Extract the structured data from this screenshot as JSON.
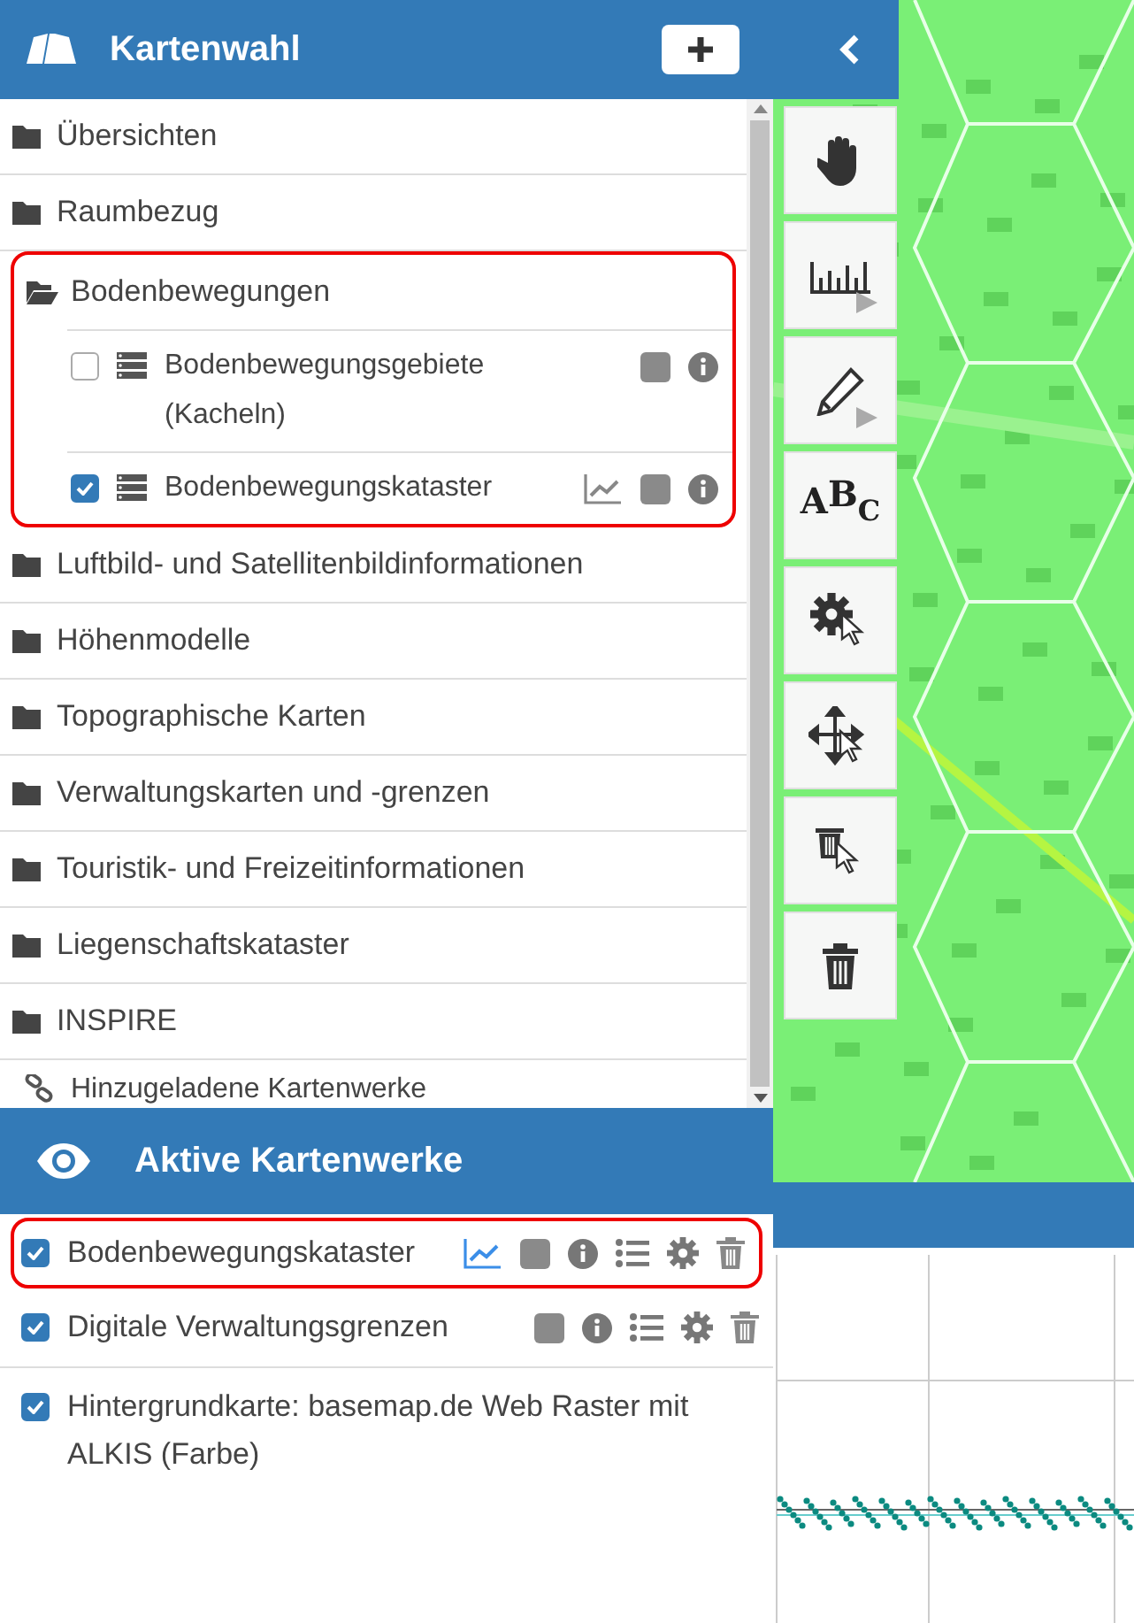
{
  "header": {
    "title": "Kartenwahl"
  },
  "tree": [
    {
      "kind": "folder",
      "label": "Übersichten",
      "expanded": false
    },
    {
      "kind": "folder",
      "label": "Raumbezug",
      "expanded": false
    },
    {
      "kind": "folder",
      "label": "Bodenbewegungen",
      "expanded": true,
      "highlighted": true,
      "children": [
        {
          "label": "Bodenbewegungsgebiete (Kacheln)",
          "checked": false,
          "chart": false
        },
        {
          "label": "Bodenbewegungskataster",
          "checked": true,
          "chart": true
        }
      ]
    },
    {
      "kind": "folder",
      "label": "Luftbild- und Satellitenbildinformationen",
      "expanded": false
    },
    {
      "kind": "folder",
      "label": "Höhenmodelle",
      "expanded": false
    },
    {
      "kind": "folder",
      "label": "Topographische Karten",
      "expanded": false
    },
    {
      "kind": "folder",
      "label": "Verwaltungskarten und -grenzen",
      "expanded": false
    },
    {
      "kind": "folder",
      "label": "Touristik- und Freizeitinformationen",
      "expanded": false
    },
    {
      "kind": "folder",
      "label": "Liegenschaftskataster",
      "expanded": false
    },
    {
      "kind": "folder",
      "label": "INSPIRE",
      "expanded": false
    },
    {
      "kind": "link",
      "label": "Hinzugeladene Kartenwerke"
    }
  ],
  "active": {
    "title": "Aktive Kartenwerke",
    "layers": [
      {
        "label": "Bodenbewegungskataster",
        "checked": true,
        "highlighted": true,
        "tools": true,
        "chart": true
      },
      {
        "label": "Digitale Verwaltungsgrenzen",
        "checked": true,
        "highlighted": false,
        "tools": true,
        "chart": false
      },
      {
        "label": "Hintergrundkarte: basemap.de Web Raster mit ALKIS (Farbe)",
        "checked": true,
        "highlighted": false,
        "tools": false,
        "chart": false
      }
    ]
  },
  "tools": [
    {
      "kind": "pan",
      "submenu": false
    },
    {
      "kind": "measure",
      "submenu": true
    },
    {
      "kind": "draw",
      "submenu": true
    },
    {
      "kind": "text",
      "glyph": "ABC",
      "submenu": false
    },
    {
      "kind": "select-settings",
      "submenu": false
    },
    {
      "kind": "select-move",
      "submenu": false
    },
    {
      "kind": "select-delete",
      "submenu": false
    },
    {
      "kind": "delete",
      "submenu": false
    }
  ]
}
